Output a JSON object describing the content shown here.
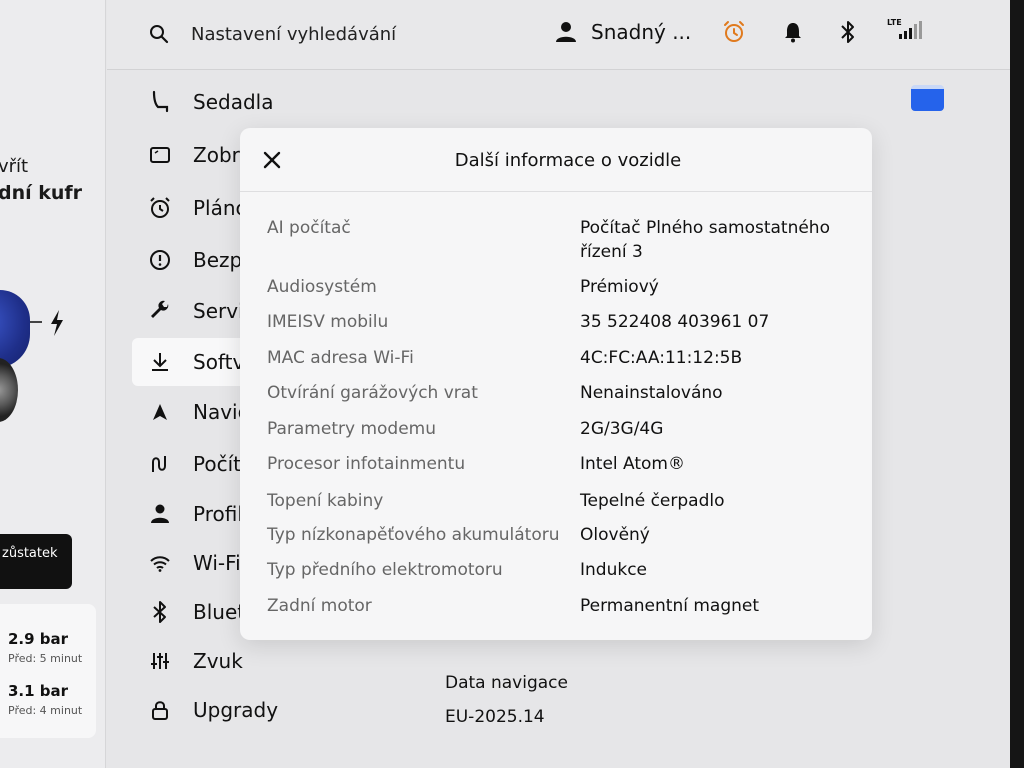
{
  "car_panel": {
    "open_line1": "vřít",
    "open_line2": "dní kufr",
    "rest_button": "zůstatek",
    "tire_pressures": [
      {
        "value": "2.9 bar",
        "time": "Před: 5 minut"
      },
      {
        "value": "3.1 bar",
        "time": "Před: 4 minut"
      }
    ]
  },
  "topbar": {
    "search_text": "Nastavení vyhledávání",
    "user_text": "Snadný ...",
    "lte_label": "LTE",
    "colors": {
      "alarm": "#e07a1e"
    }
  },
  "menu": {
    "items": [
      {
        "label": "Sedadla",
        "icon": "seat-icon"
      },
      {
        "label": "Zobra",
        "icon": "display-icon"
      },
      {
        "label": "Plánc",
        "icon": "alarm-clock-icon"
      },
      {
        "label": "Bezp",
        "icon": "alert-circle-icon"
      },
      {
        "label": "Servi",
        "icon": "wrench-icon"
      },
      {
        "label": "Softv",
        "icon": "download-icon"
      },
      {
        "label": "Navig",
        "icon": "navigation-arrow-icon"
      },
      {
        "label": "Počít",
        "icon": "trip-icon"
      },
      {
        "label": "Profil",
        "icon": "person-icon"
      },
      {
        "label": "Wi-Fi",
        "icon": "wifi-icon"
      },
      {
        "label": "Bluet",
        "icon": "bluetooth-icon"
      },
      {
        "label": "Zvuk",
        "icon": "equalizer-icon"
      },
      {
        "label": "Upgrady",
        "icon": "lock-icon"
      }
    ]
  },
  "software": {
    "nav_data_label": "Data navigace",
    "nav_data_value": "EU-2025.14"
  },
  "modal": {
    "title": "Další informace o vozidle",
    "rows": [
      {
        "label": "AI počítač",
        "value": "Počítač Plného samostatného řízení 3"
      },
      {
        "label": "Audiosystém",
        "value": "Prémiový"
      },
      {
        "label": "IMEISV mobilu",
        "value": "35 522408 403961 07"
      },
      {
        "label": "MAC adresa Wi-Fi",
        "value": "4C:FC:AA:11:12:5B"
      },
      {
        "label": "Otvírání garážových vrat",
        "value": "Nenainstalováno"
      },
      {
        "label": "Parametry modemu",
        "value": "2G/3G/4G"
      },
      {
        "label": "Procesor infotainmentu",
        "value": "Intel Atom®"
      },
      {
        "label": "Topení kabiny",
        "value": "Tepelné čerpadlo"
      },
      {
        "label": "Typ nízkonapěťového akumulátoru",
        "value": "Olověný"
      },
      {
        "label": "Typ předního elektromotoru",
        "value": "Indukce"
      },
      {
        "label": "Zadní motor",
        "value": "Permanentní magnet"
      }
    ]
  }
}
